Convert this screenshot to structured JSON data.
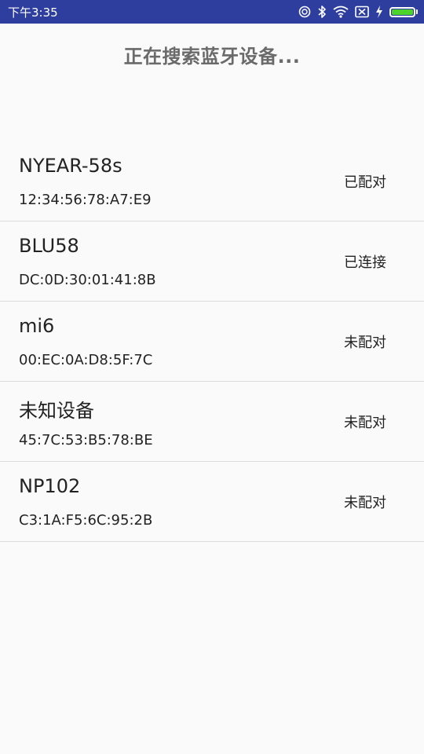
{
  "status_bar": {
    "time": "下午3:35",
    "icons": [
      "alarm-icon",
      "bluetooth-icon",
      "wifi-icon",
      "no-sim-icon",
      "charging-icon",
      "battery-icon"
    ],
    "battery_level": 1.0,
    "battery_color": "#4cd22a",
    "background_color": "#2e3e9f"
  },
  "page": {
    "title": "正在搜索蓝牙设备..."
  },
  "devices": [
    {
      "name": "NYEAR-58s",
      "mac": "12:34:56:78:A7:E9",
      "status": "已配对"
    },
    {
      "name": "BLU58",
      "mac": "DC:0D:30:01:41:8B",
      "status": "已连接"
    },
    {
      "name": "mi6",
      "mac": "00:EC:0A:D8:5F:7C",
      "status": "未配对"
    },
    {
      "name": "未知设备",
      "mac": "45:7C:53:B5:78:BE",
      "status": "未配对"
    },
    {
      "name": "NP102",
      "mac": "C3:1A:F5:6C:95:2B",
      "status": "未配对"
    }
  ]
}
